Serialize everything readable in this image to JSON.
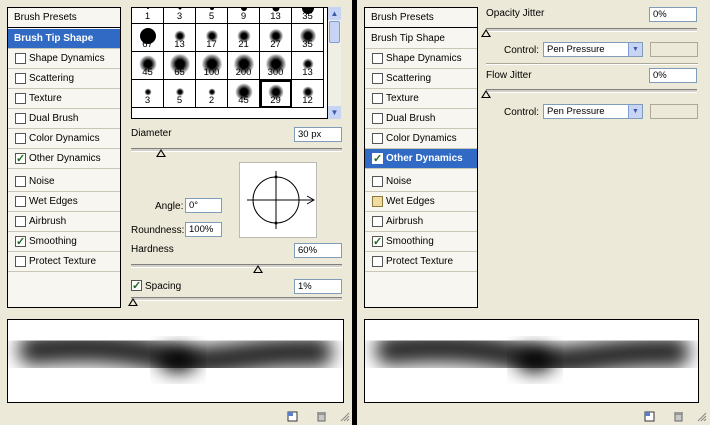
{
  "colors": {
    "selection": "#316ac5",
    "check": "#1c6b1c"
  },
  "left_panel": {
    "sidebar": {
      "header": "Brush Presets",
      "items": [
        {
          "label": "Brush Tip Shape",
          "checkbox": false,
          "checked": false,
          "selected": true
        },
        {
          "label": "Shape Dynamics",
          "checkbox": true,
          "checked": false,
          "selected": false
        },
        {
          "label": "Scattering",
          "checkbox": true,
          "checked": false,
          "selected": false
        },
        {
          "label": "Texture",
          "checkbox": true,
          "checked": false,
          "selected": false
        },
        {
          "label": "Dual Brush",
          "checkbox": true,
          "checked": false,
          "selected": false
        },
        {
          "label": "Color Dynamics",
          "checkbox": true,
          "checked": false,
          "selected": false
        },
        {
          "label": "Other Dynamics",
          "checkbox": true,
          "checked": true,
          "selected": false
        },
        {
          "label": "Noise",
          "checkbox": true,
          "checked": false,
          "selected": false
        },
        {
          "label": "Wet Edges",
          "checkbox": true,
          "checked": false,
          "selected": false
        },
        {
          "label": "Airbrush",
          "checkbox": true,
          "checked": false,
          "selected": false
        },
        {
          "label": "Smoothing",
          "checkbox": true,
          "checked": true,
          "selected": false
        },
        {
          "label": "Protect Texture",
          "checkbox": true,
          "checked": false,
          "selected": false
        }
      ]
    },
    "brush_grid": {
      "rows": [
        [
          "1",
          "3",
          "5",
          "9",
          "13",
          "35"
        ],
        [
          "67",
          "13",
          "17",
          "21",
          "27",
          "35"
        ],
        [
          "45",
          "65",
          "100",
          "200",
          "300",
          "13"
        ],
        [
          "3",
          "5",
          "2",
          "45",
          "29",
          "12"
        ]
      ],
      "selected": "29"
    },
    "diameter": {
      "label": "Diameter",
      "value": "30 px",
      "level": 0.14
    },
    "angle": {
      "label": "Angle:",
      "value": "0°"
    },
    "roundness": {
      "label": "Roundness:",
      "value": "100%"
    },
    "hardness": {
      "label": "Hardness",
      "value": "60%",
      "level": 0.6
    },
    "spacing": {
      "label": "Spacing",
      "value": "1%",
      "checked": true,
      "level": 0.01
    }
  },
  "right_panel": {
    "sidebar": {
      "header": "Brush Presets",
      "items": [
        {
          "label": "Brush Tip Shape",
          "checkbox": false,
          "checked": false,
          "selected": false
        },
        {
          "label": "Shape Dynamics",
          "checkbox": true,
          "checked": false,
          "selected": false
        },
        {
          "label": "Scattering",
          "checkbox": true,
          "checked": false,
          "selected": false
        },
        {
          "label": "Texture",
          "checkbox": true,
          "checked": false,
          "selected": false
        },
        {
          "label": "Dual Brush",
          "checkbox": true,
          "checked": false,
          "selected": false
        },
        {
          "label": "Color Dynamics",
          "checkbox": true,
          "checked": false,
          "selected": false
        },
        {
          "label": "Other Dynamics",
          "checkbox": true,
          "checked": true,
          "selected": true
        },
        {
          "label": "Noise",
          "checkbox": true,
          "checked": false,
          "selected": false
        },
        {
          "label": "Wet Edges",
          "checkbox": true,
          "checked": false,
          "selected": false
        },
        {
          "label": "Airbrush",
          "checkbox": true,
          "checked": false,
          "selected": false
        },
        {
          "label": "Smoothing",
          "checkbox": true,
          "checked": true,
          "selected": false
        },
        {
          "label": "Protect Texture",
          "checkbox": true,
          "checked": false,
          "selected": false
        }
      ]
    },
    "opacity_jitter": {
      "label": "Opacity Jitter",
      "value": "0%",
      "level": 0,
      "control_label": "Control:",
      "control_value": "Pen Pressure"
    },
    "flow_jitter": {
      "label": "Flow Jitter",
      "value": "0%",
      "level": 0,
      "control_label": "Control:",
      "control_value": "Pen Pressure"
    }
  },
  "icons": {
    "new_brush": "new-brush-icon",
    "delete": "trash-icon",
    "resize": "resize-grip-icon"
  }
}
